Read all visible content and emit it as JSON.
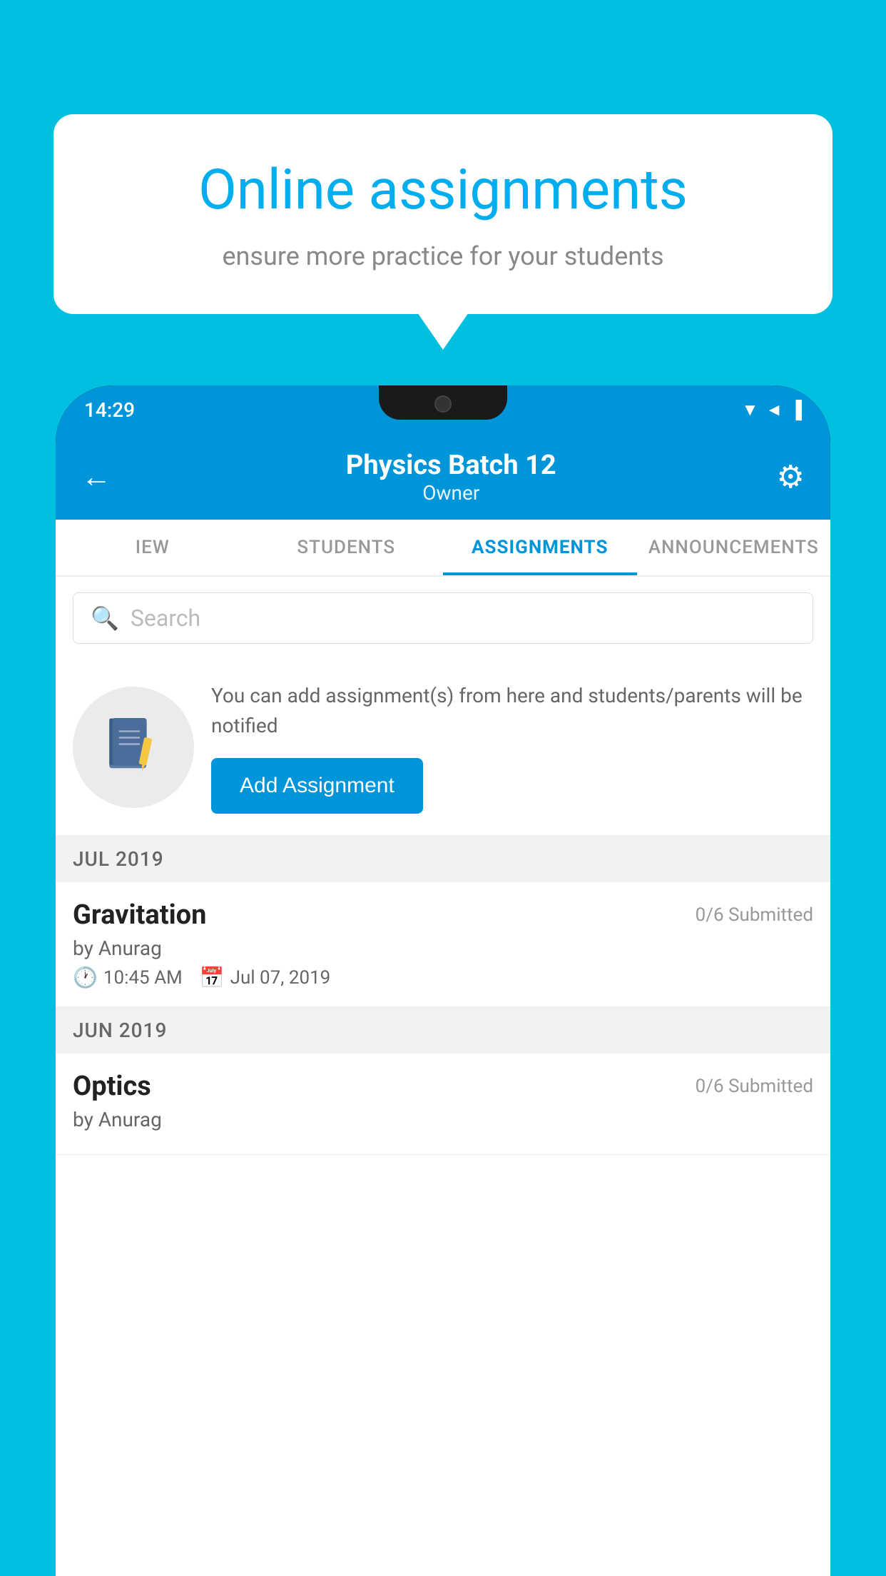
{
  "background": {
    "color": "#00BFDF"
  },
  "bubble": {
    "title": "Online assignments",
    "subtitle": "ensure more practice for your students"
  },
  "phone": {
    "status_bar": {
      "time": "14:29",
      "icons": "▼◄▐"
    },
    "app_bar": {
      "title": "Physics Batch 12",
      "subtitle": "Owner",
      "back_label": "←",
      "settings_label": "⚙"
    },
    "tabs": [
      {
        "label": "IEW",
        "active": false
      },
      {
        "label": "STUDENTS",
        "active": false
      },
      {
        "label": "ASSIGNMENTS",
        "active": true
      },
      {
        "label": "ANNOUNCEMENTS",
        "active": false
      }
    ],
    "search": {
      "placeholder": "Search"
    },
    "promo": {
      "description": "You can add assignment(s) from here and students/parents will be notified",
      "button_label": "Add Assignment"
    },
    "sections": [
      {
        "label": "JUL 2019",
        "assignments": [
          {
            "name": "Gravitation",
            "submitted": "0/6 Submitted",
            "by": "by Anurag",
            "time": "10:45 AM",
            "date": "Jul 07, 2019"
          }
        ]
      },
      {
        "label": "JUN 2019",
        "assignments": [
          {
            "name": "Optics",
            "submitted": "0/6 Submitted",
            "by": "by Anurag",
            "time": "",
            "date": ""
          }
        ]
      }
    ]
  }
}
